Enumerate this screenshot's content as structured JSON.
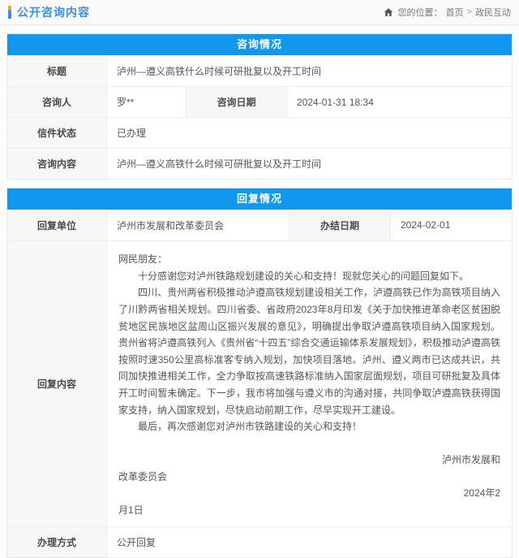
{
  "page_header": {
    "title": "公开咨询内容",
    "breadcrumb": {
      "prefix": "您的位置：",
      "home": "首页",
      "separator": ">",
      "current": "政民互动"
    }
  },
  "consult_section": {
    "header": "咨询情况",
    "title_label": "标题",
    "title_value": "泸州—遵义高铁什么时候可研批复以及开工时间",
    "person_label": "咨询人",
    "person_value": "罗**",
    "date_label": "咨询日期",
    "date_value": "2024-01-31 18:34",
    "status_label": "信件状态",
    "status_value": "已办理",
    "content_label": "咨询内容",
    "content_value": "泸州—遵义高铁什么时候可研批复以及开工时间"
  },
  "reply_section": {
    "header": "回复情况",
    "unit_label": "回复单位",
    "unit_value": "泸州市发展和改革委员会",
    "finish_date_label": "办结日期",
    "finish_date_value": "2024-02-01",
    "content_label": "回复内容",
    "content": {
      "salutation": "网民朋友：",
      "paragraphs": [
        "十分感谢您对泸州铁路规划建设的关心和支持！现就您关心的问题回复如下。",
        "四川、贵州两省积极推动泸遵高铁规划建设相关工作，泸遵高铁已作为高铁项目纳入了川黔两省相关规划。四川省委、省政府2023年8月印发《关于加快推进革命老区贫困脱贫地区民族地区盆周山区振兴发展的意见》，明确提出争取泸遵高铁项目纳入国家规划。贵州省将泸遵高铁列入《贵州省“十四五”综合交通运输体系发展规划》，积极推动泸遵高铁按照时速350公里高标准客专纳入规划，加快项目落地。泸州、遵义两市已达成共识，共同加快推进相关工作，全力争取按高速铁路标准纳入国家层面规划，项目可研批复及具体开工时间暂未确定。下一步，我市将加强与遵义市的沟通对接，共同争取泸遵高铁获得国家支持，纳入国家规划，尽快启动前期工作，尽早实现开工建设。",
        "最后，再次感谢您对泸州市铁路建设的关心和支持！"
      ],
      "signature_unit_line1": "泸州市发展和",
      "signature_unit_line2": "改革委员会",
      "signature_date_line1": "2024年2",
      "signature_date_line2": "月1日"
    },
    "method_label": "办理方式",
    "method_value": "公开回复"
  },
  "colors": {
    "section_header_bg": "#1297ef",
    "title_blue": "#3b8de0",
    "accent_orange": "#f6a23c",
    "label_bg": "#f7f7f7",
    "border": "#e9e9e9"
  }
}
